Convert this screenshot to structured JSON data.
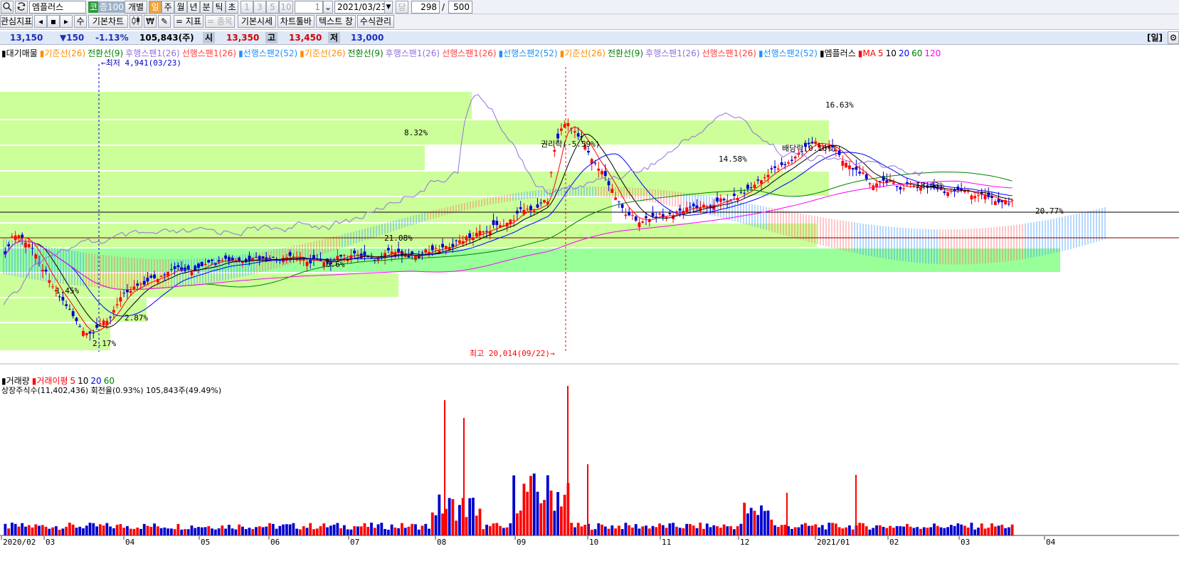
{
  "toolbar1": {
    "search_icon": "search-icon",
    "refresh_icon": "refresh-icon",
    "stock_name": "엠플러스",
    "market_badge": "코",
    "margin_badge": "증100",
    "individual": "개별",
    "periods": [
      "일",
      "주",
      "월",
      "년",
      "분",
      "틱",
      "초"
    ],
    "minutes": [
      "1",
      "3",
      "5",
      "10"
    ],
    "count_value": "1",
    "date_value": "2021/03/23",
    "period_btn": "당",
    "display_count": "298",
    "slash": "/",
    "total_count": "500"
  },
  "toolbar2": {
    "watch_indicator": "관심지표",
    "basic_chart": "기본차트",
    "indicator_btn": "= 지표",
    "item_btn": "= 종목",
    "basic_quote": "기본시세",
    "chart_toolbar": "차트툴바",
    "text_window": "텍스트 창",
    "formula": "수식관리",
    "su_btn": "수"
  },
  "quote": {
    "price": "13,150",
    "change": "▼150",
    "change_pct": "-1.13%",
    "volume": "105,843(주)",
    "open_label": "시",
    "open": "13,350",
    "high_label": "고",
    "high": "13,450",
    "low_label": "저",
    "low": "13,000",
    "period_tag": "[일]"
  },
  "price_legend": [
    {
      "text": "▮대기매물",
      "color": "#000000"
    },
    {
      "text": "▮기준선(26)",
      "color": "#ff8c00"
    },
    {
      "text": "전환선(9)",
      "color": "#008000"
    },
    {
      "text": "후행스팬1(26)",
      "color": "#9370db"
    },
    {
      "text": "선행스팬1(26)",
      "color": "#ff4040"
    },
    {
      "text": "▮선행스팬2(52)",
      "color": "#1e90ff"
    },
    {
      "text": "▮기준선(26)",
      "color": "#ff8c00"
    },
    {
      "text": "전환선(9)",
      "color": "#008000"
    },
    {
      "text": "후행스팬1(26)",
      "color": "#9370db"
    },
    {
      "text": "선행스팬1(26)",
      "color": "#ff4040"
    },
    {
      "text": "▮선행스팬2(52)",
      "color": "#1e90ff"
    },
    {
      "text": "▮기준선(26)",
      "color": "#ff8c00"
    },
    {
      "text": "전환선(9)",
      "color": "#008000"
    },
    {
      "text": "후행스팬1(26)",
      "color": "#9370db"
    },
    {
      "text": "선행스팬1(26)",
      "color": "#ff4040"
    },
    {
      "text": "▮선행스팬2(52)",
      "color": "#1e90ff"
    },
    {
      "text": "▮엠플러스",
      "color": "#000000"
    },
    {
      "text": "▮MA",
      "color": "#ff0000"
    },
    {
      "text": "5",
      "color": "#ff0000"
    },
    {
      "text": "10",
      "color": "#000000"
    },
    {
      "text": "20",
      "color": "#0000ff"
    },
    {
      "text": "60",
      "color": "#008000"
    },
    {
      "text": "120",
      "color": "#ff00ff"
    }
  ],
  "volume_legend": [
    {
      "text": "▮거래량",
      "color": "#000000"
    },
    {
      "text": "▮거래이평",
      "color": "#ff0000"
    },
    {
      "text": "5",
      "color": "#ff0000"
    },
    {
      "text": "10",
      "color": "#000000"
    },
    {
      "text": "20",
      "color": "#0000ff"
    },
    {
      "text": "60",
      "color": "#008000"
    }
  ],
  "volume_info": "상장주식수(11,402,436) 회전율(0.93%) 105,843주(49.49%)",
  "annotations": {
    "low_marker": "←최저 4,941(03/23)",
    "high_marker": "최고 20,014(09/22)→",
    "rights_ex": "권리락(-5.59%)",
    "dividend_ex": "배당락(0.10%)"
  },
  "profile_labels": [
    "8.32%",
    "14.58%",
    "16.63%",
    "1.45%",
    "2.87%",
    "2.17%",
    "21.08%",
    "6.6%",
    "18.43%",
    "20.77%"
  ],
  "x_axis_labels": [
    "2020/02",
    "03",
    "04",
    "05",
    "06",
    "07",
    "08",
    "09",
    "10",
    "11",
    "12",
    "2021/01",
    "02",
    "03",
    "04"
  ],
  "colors": {
    "up": "#ff0000",
    "down": "#0000cd",
    "profile": "#ccff99",
    "profile_strong": "#99ff99"
  }
}
